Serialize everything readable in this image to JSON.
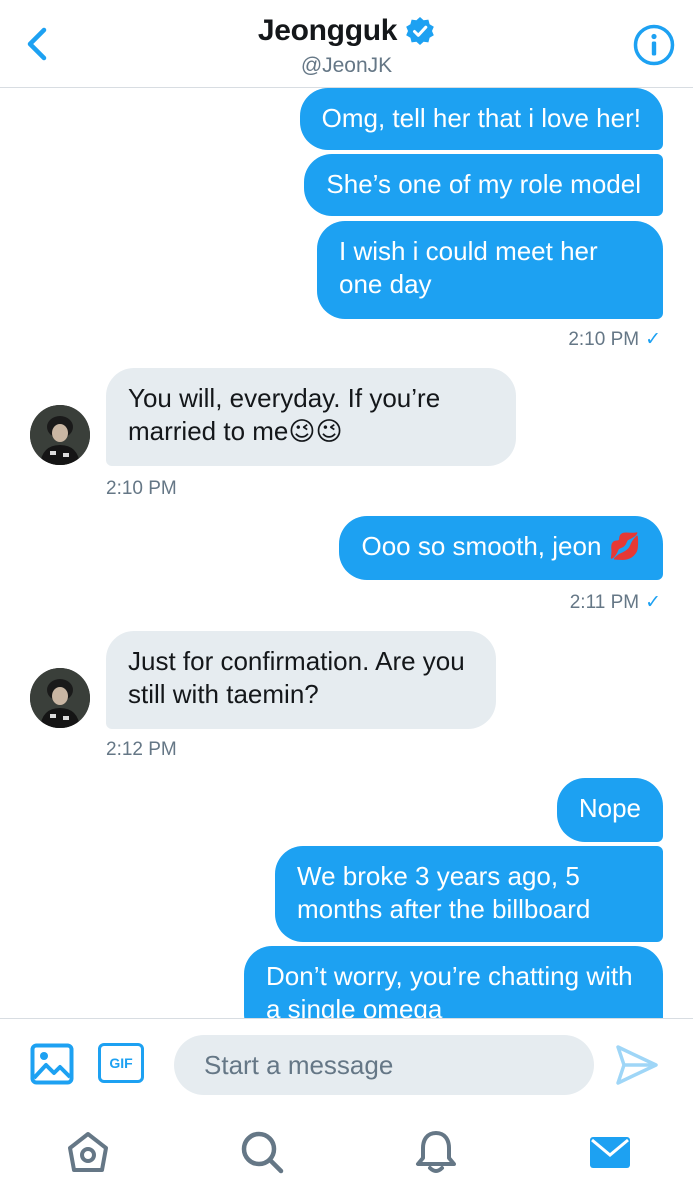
{
  "header": {
    "name": "Jeongguk",
    "handle": "@JeonJK"
  },
  "messages": [
    {
      "id": "m1",
      "side": "out",
      "text": "Omg, tell her that i love her!"
    },
    {
      "id": "m2",
      "side": "out",
      "text": "She’s one of my role model"
    },
    {
      "id": "m3",
      "side": "out",
      "text": "I wish i could meet her one day"
    },
    {
      "id": "t1",
      "type": "time",
      "text": "2:10 PM",
      "read": "✓"
    },
    {
      "id": "m4",
      "side": "in",
      "text": "You will, everyday. If you’re married to me😉😉"
    },
    {
      "id": "t2",
      "type": "time",
      "text": "2:10 PM"
    },
    {
      "id": "m5",
      "side": "out",
      "text": "Ooo so smooth, jeon 💋"
    },
    {
      "id": "t3",
      "type": "time",
      "text": "2:11 PM",
      "read": "✓"
    },
    {
      "id": "m6",
      "side": "in",
      "text": "Just for confirmation. Are you still with taemin?"
    },
    {
      "id": "t4",
      "type": "time",
      "text": "2:12 PM"
    },
    {
      "id": "m7",
      "side": "out",
      "text": "Nope"
    },
    {
      "id": "m8",
      "side": "out",
      "text": "We broke 3 years ago, 5 months after the billboard"
    },
    {
      "id": "m9",
      "side": "out",
      "text": "Don’t worry, you’re chatting with a single omega"
    }
  ],
  "composer": {
    "placeholder": "Start a message",
    "gif_label": "GIF"
  },
  "colors": {
    "accent": "#1da1f2",
    "incoming_bubble": "#e6ecf0",
    "muted_text": "#657786"
  },
  "icons": [
    "back-chevron-icon",
    "verified-badge-icon",
    "info-icon",
    "image-icon",
    "gif-icon",
    "send-icon",
    "home-icon",
    "search-icon",
    "notifications-bell-icon",
    "messages-envelope-icon"
  ]
}
